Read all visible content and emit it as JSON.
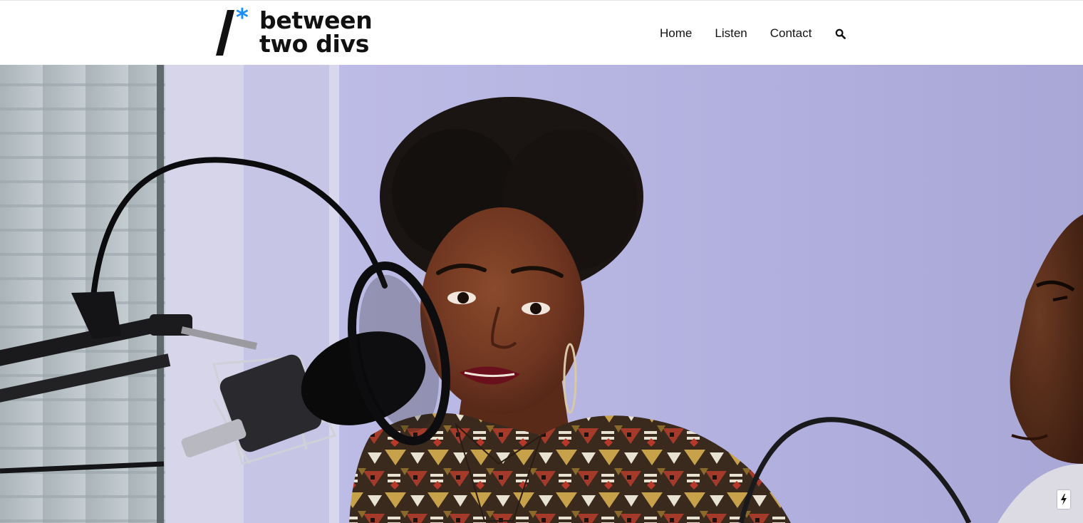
{
  "header": {
    "logo": {
      "slash": "/",
      "asterisk": "*",
      "line1": "between",
      "line2": "two divs",
      "accent_color": "#1a8cff"
    },
    "nav": {
      "items": [
        {
          "label": "Home"
        },
        {
          "label": "Listen"
        },
        {
          "label": "Contact"
        }
      ],
      "search_icon": "search-icon"
    }
  },
  "hero": {
    "image_subject": "podcast-recording-photo",
    "background_color": "#b3b0dc",
    "quick_action_icon": "lightning-bolt-icon"
  }
}
